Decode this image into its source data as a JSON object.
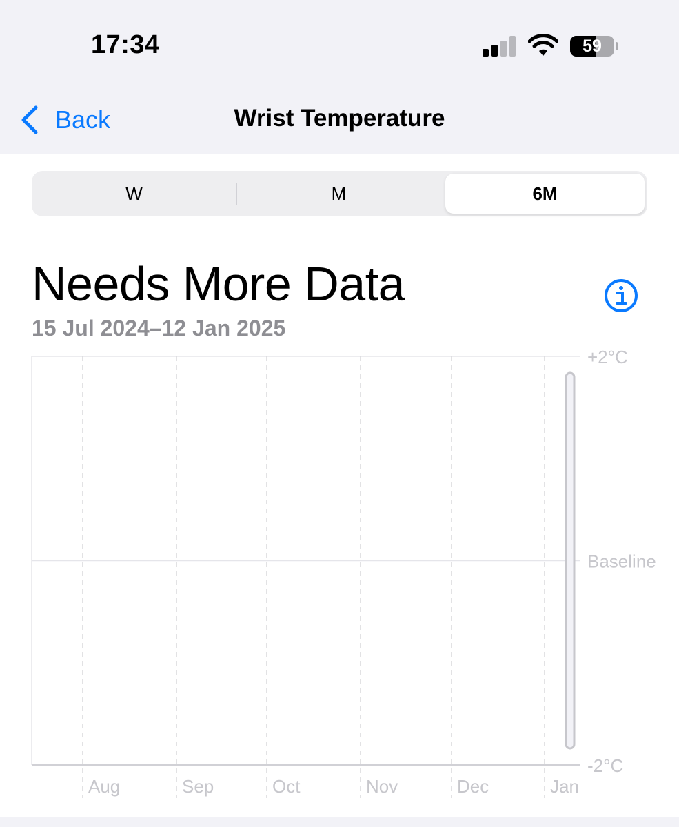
{
  "status_bar": {
    "time": "17:34",
    "signal_bars_active": 2,
    "signal_bars_total": 4,
    "battery_percent": "59",
    "icons": [
      "cellular-signal-icon",
      "wifi-icon",
      "battery-icon"
    ]
  },
  "nav": {
    "back_label": "Back",
    "title": "Wrist Temperature"
  },
  "segments": [
    {
      "label": "W",
      "selected": false
    },
    {
      "label": "M",
      "selected": false
    },
    {
      "label": "6M",
      "selected": true
    }
  ],
  "summary": {
    "headline": "Needs More Data",
    "date_range": "15 Jul 2024–12 Jan 2025",
    "info_icon": "info-circle-icon"
  },
  "colors": {
    "accent": "#0a7aff",
    "secondary_text": "#8e8e93",
    "axis_label": "#c7c7cc",
    "grid": "#e5e5ea",
    "background": "#f2f2f7"
  },
  "chart_data": {
    "type": "line",
    "title": "",
    "xlabel": "",
    "ylabel": "",
    "x_tick_labels": [
      "Aug",
      "Sep",
      "Oct",
      "Nov",
      "Dec",
      "Jan"
    ],
    "x_range": [
      "15 Jul 2024",
      "12 Jan 2025"
    ],
    "y_tick_labels": [
      "+2°C",
      "Baseline",
      "-2°C"
    ],
    "y_ticks": [
      2,
      0,
      -2
    ],
    "ylim": [
      -2,
      2
    ],
    "series": [],
    "grid": true,
    "range_indicator": "empty range bar near right edge"
  }
}
